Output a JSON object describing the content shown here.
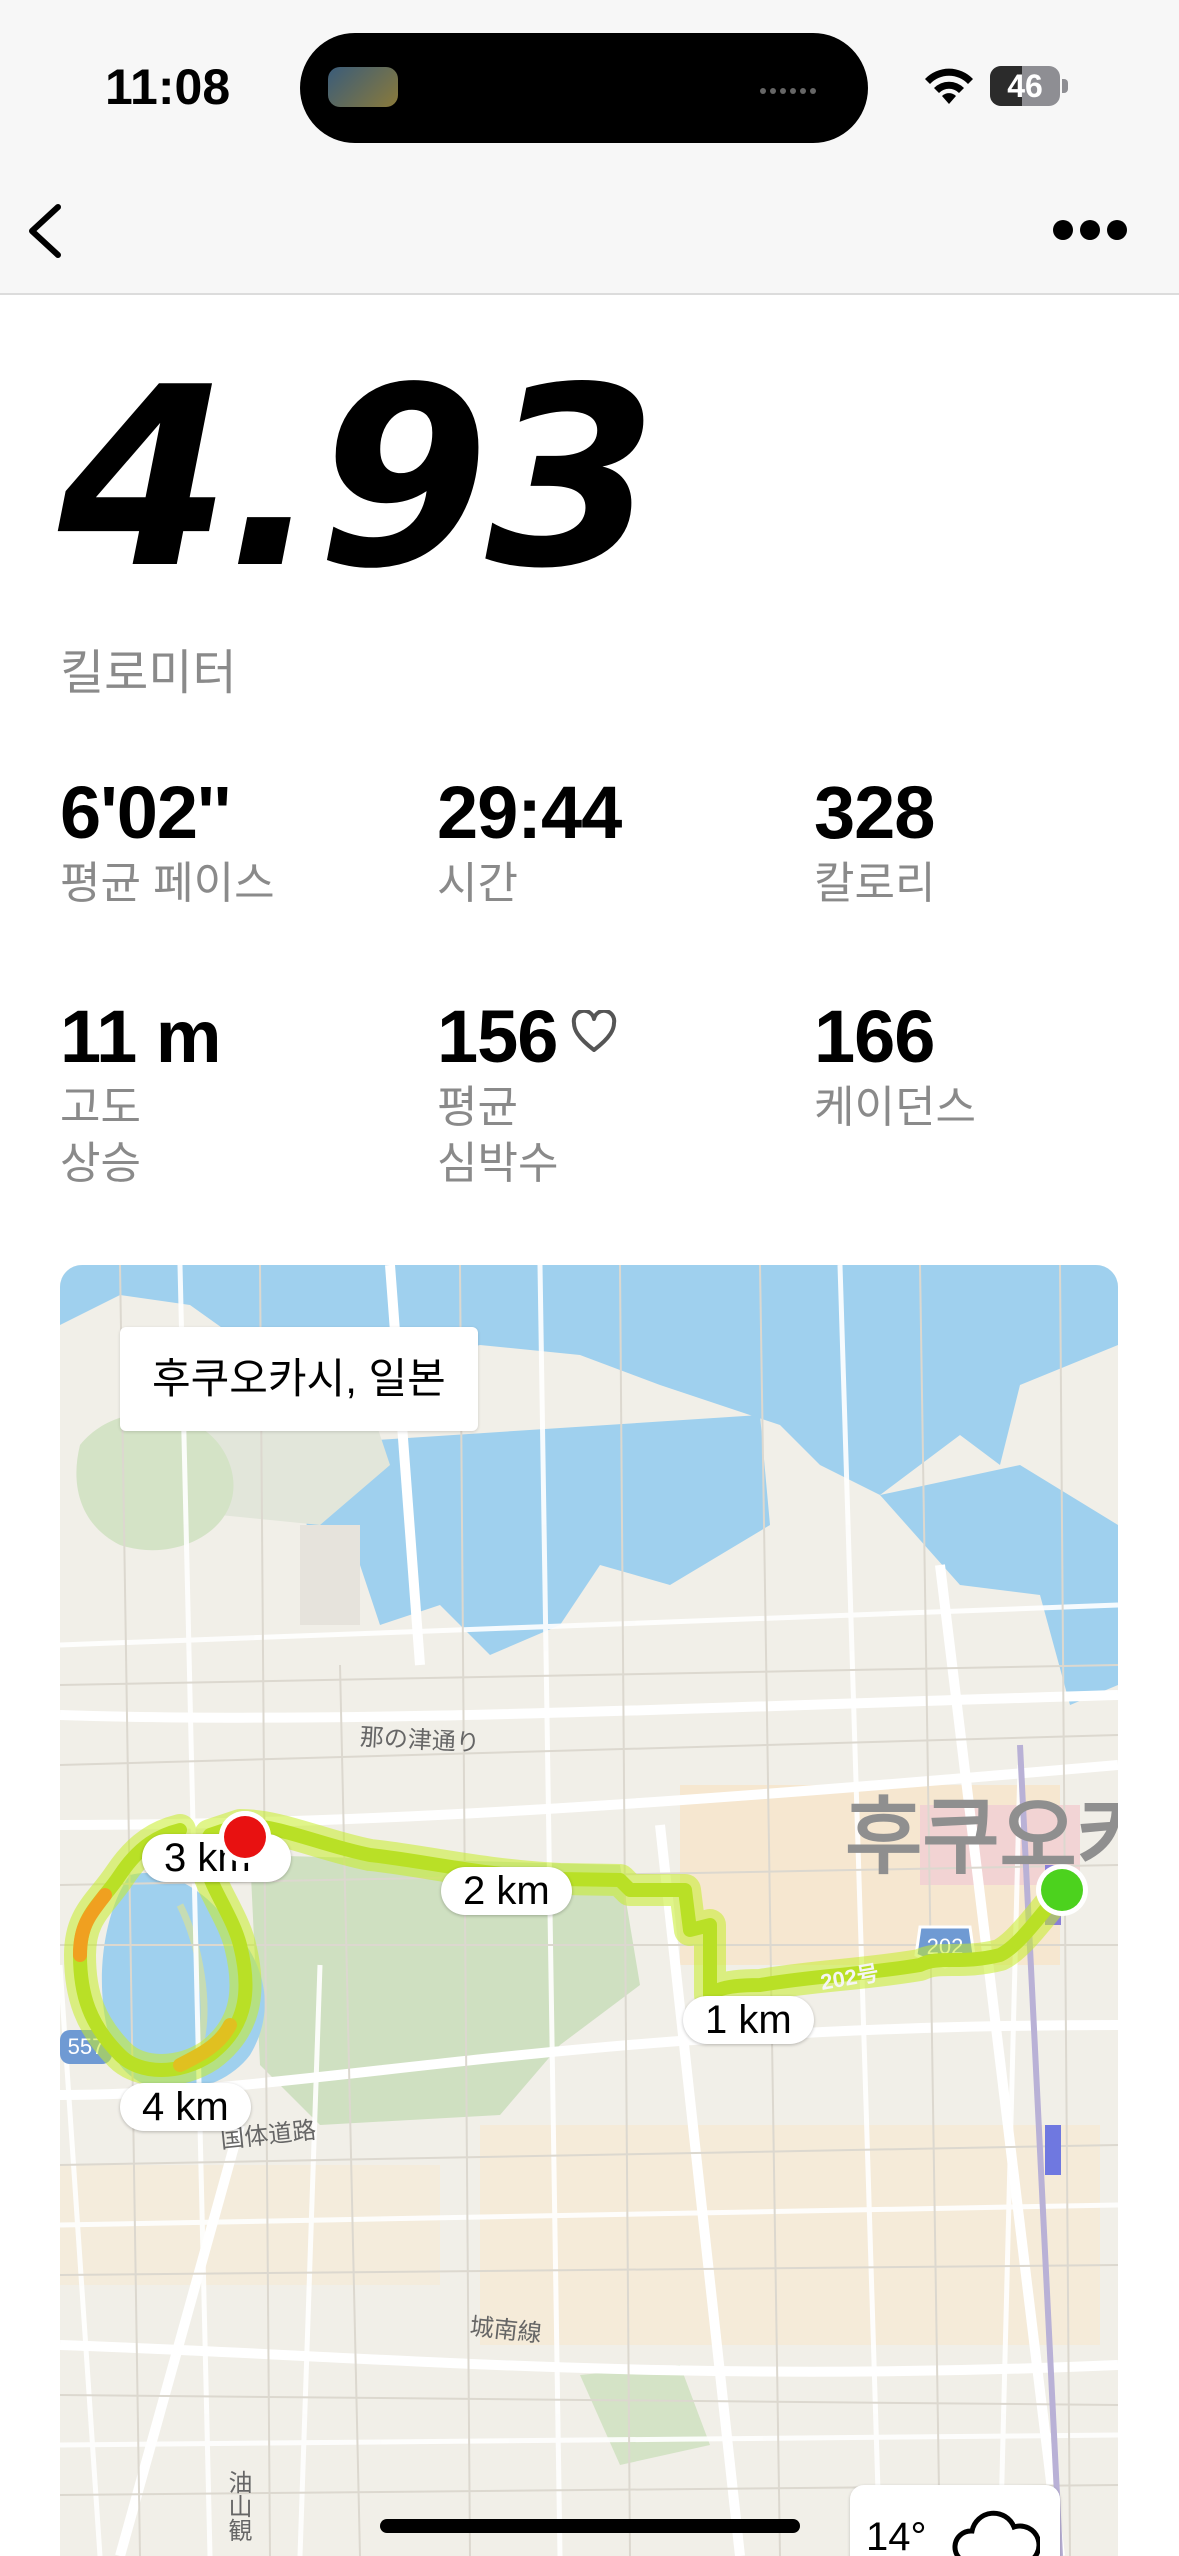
{
  "status_bar": {
    "time": "11:08",
    "battery": "46",
    "battery_level": 0.46
  },
  "summary": {
    "distance": "4.93",
    "unit": "킬로미터"
  },
  "stats": [
    {
      "value": "6'02''",
      "label": "평균 페이스"
    },
    {
      "value": "29:44",
      "label": "시간"
    },
    {
      "value": "328",
      "label": "칼로리"
    },
    {
      "value": "11 m",
      "label_line1": "고도",
      "label_line2": "상승"
    },
    {
      "value": "156",
      "label_line1": "평균",
      "label_line2": "심박수",
      "icon": "heart-icon"
    },
    {
      "value": "166",
      "label": "케이던스"
    }
  ],
  "map": {
    "location": "후쿠오카시, 일본",
    "city_label": "후쿠오카",
    "street_labels": [
      "那の津通り",
      "国体道路",
      "城南線",
      "油山観"
    ],
    "road_badges": [
      "557",
      "202",
      "202号"
    ],
    "km_markers": [
      "1 km",
      "2 km",
      "3 km",
      "4 km"
    ],
    "start_color": "#4cd21e",
    "end_color": "#e81111",
    "route_color": "#b9e026",
    "weather_temp": "14°"
  }
}
